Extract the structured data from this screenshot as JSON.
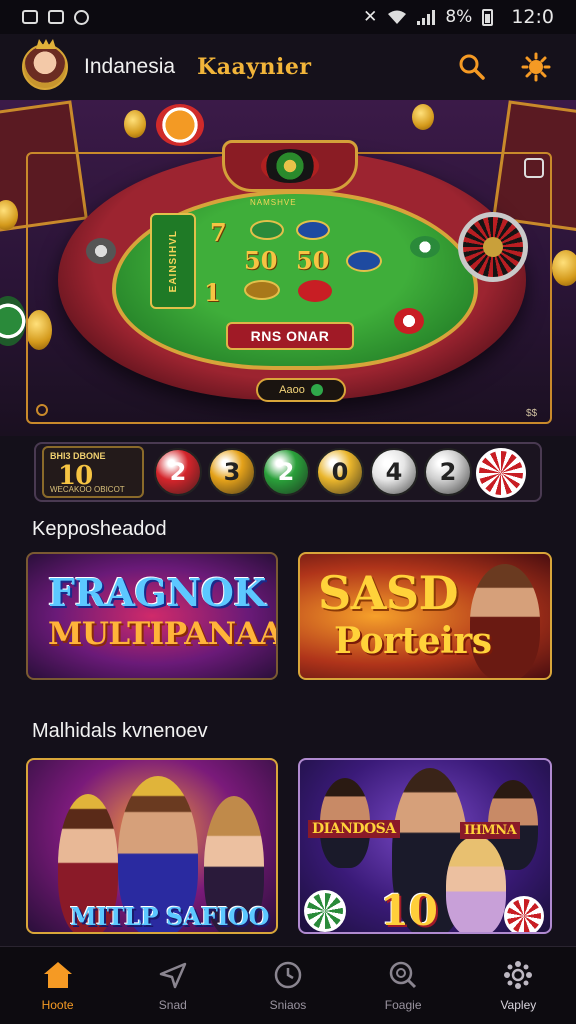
{
  "status_bar": {
    "battery": "8%",
    "time": "12:0"
  },
  "header": {
    "region": "Indanesia",
    "brand": "Kaaynier"
  },
  "hero": {
    "side_text": "EAINSIHVL",
    "felt_title": "NAMSHVE",
    "grid": [
      "7",
      "50",
      "50",
      "1"
    ],
    "sign": "RNS ONAR",
    "plaque": "Aaoo",
    "corner_right": "$$"
  },
  "results": {
    "label_top": "BHI3 DBONE",
    "label_big": "10",
    "label_bottom": "WECAKOO OBICOT",
    "balls": [
      {
        "value": "2",
        "color": "#d4252b"
      },
      {
        "value": "3",
        "color": "#e5a21a"
      },
      {
        "value": "2",
        "color": "#2aa03a"
      },
      {
        "value": "0",
        "color": "#e9b52c"
      },
      {
        "value": "4",
        "color": "#e6e6e6"
      },
      {
        "value": "2",
        "color": "#cfcfcf"
      }
    ]
  },
  "sections": [
    {
      "title": "Kepposheadod",
      "cards": [
        {
          "line1": "FRAGNOK",
          "line2": "MULTIPANAAS"
        },
        {
          "line1": "SASD",
          "line2": "Porteirs"
        }
      ]
    },
    {
      "title": "Malhidals kvnenoev",
      "cards": [
        {
          "line1": "MITLP SAFIOO"
        },
        {
          "line1": "DIANDOSA",
          "line2": "IHMNA",
          "line3": "10"
        }
      ]
    }
  ],
  "nav": [
    {
      "label": "Hoote",
      "icon": "home-icon",
      "active": true
    },
    {
      "label": "Snad",
      "icon": "plane-icon"
    },
    {
      "label": "Sniaos",
      "icon": "clock-icon"
    },
    {
      "label": "Foagie",
      "icon": "search-icon"
    },
    {
      "label": "Vapley",
      "icon": "settings-icon"
    }
  ],
  "colors": {
    "accent": "#f59a24",
    "brand": "#f2b53a",
    "background": "#14101a"
  }
}
